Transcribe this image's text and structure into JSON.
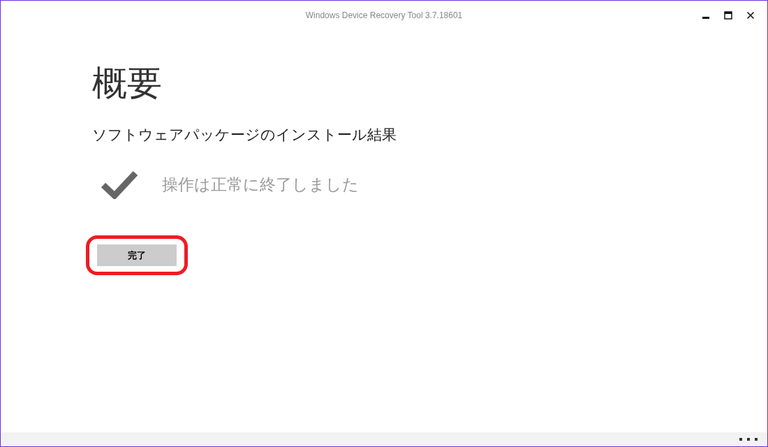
{
  "window": {
    "title": "Windows Device Recovery Tool 3.7.18601"
  },
  "page": {
    "heading": "概要",
    "subtitle": "ソフトウェアパッケージのインストール結果",
    "status": {
      "kind": "success",
      "message": "操作は正常に終了しました"
    }
  },
  "buttons": [
    {
      "label": "完了",
      "highlighted": true
    }
  ]
}
